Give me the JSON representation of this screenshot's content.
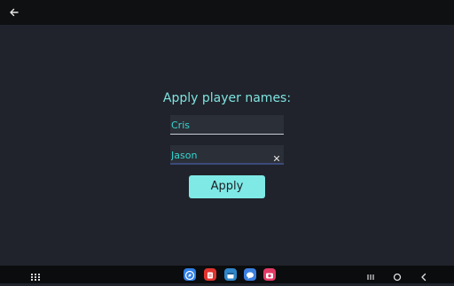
{
  "header": {
    "back_icon": "arrow-left-icon"
  },
  "form": {
    "prompt": "Apply player names:",
    "player1": {
      "value": "Cris",
      "placeholder": ""
    },
    "player2": {
      "value": "Jason",
      "placeholder": ""
    },
    "clear_icon": "close-icon",
    "apply_label": "Apply"
  },
  "taskbar": {
    "apps_icon": "app-grid-icon",
    "apps": [
      {
        "icon": "compass-icon",
        "color": "#2f7fe6"
      },
      {
        "icon": "note-icon",
        "color": "#e2332e"
      },
      {
        "icon": "calendar-icon",
        "color": "#2f86c9"
      },
      {
        "icon": "chat-icon",
        "color": "#3c7fe0"
      },
      {
        "icon": "camera-icon",
        "color": "#e23a66"
      }
    ],
    "recents_icon": "recents-icon",
    "home_icon": "home-icon",
    "back_icon": "nav-back-icon"
  },
  "colors": {
    "background": "#20232b",
    "accent": "#7fe9e6",
    "text_accent": "#35d6cf"
  }
}
